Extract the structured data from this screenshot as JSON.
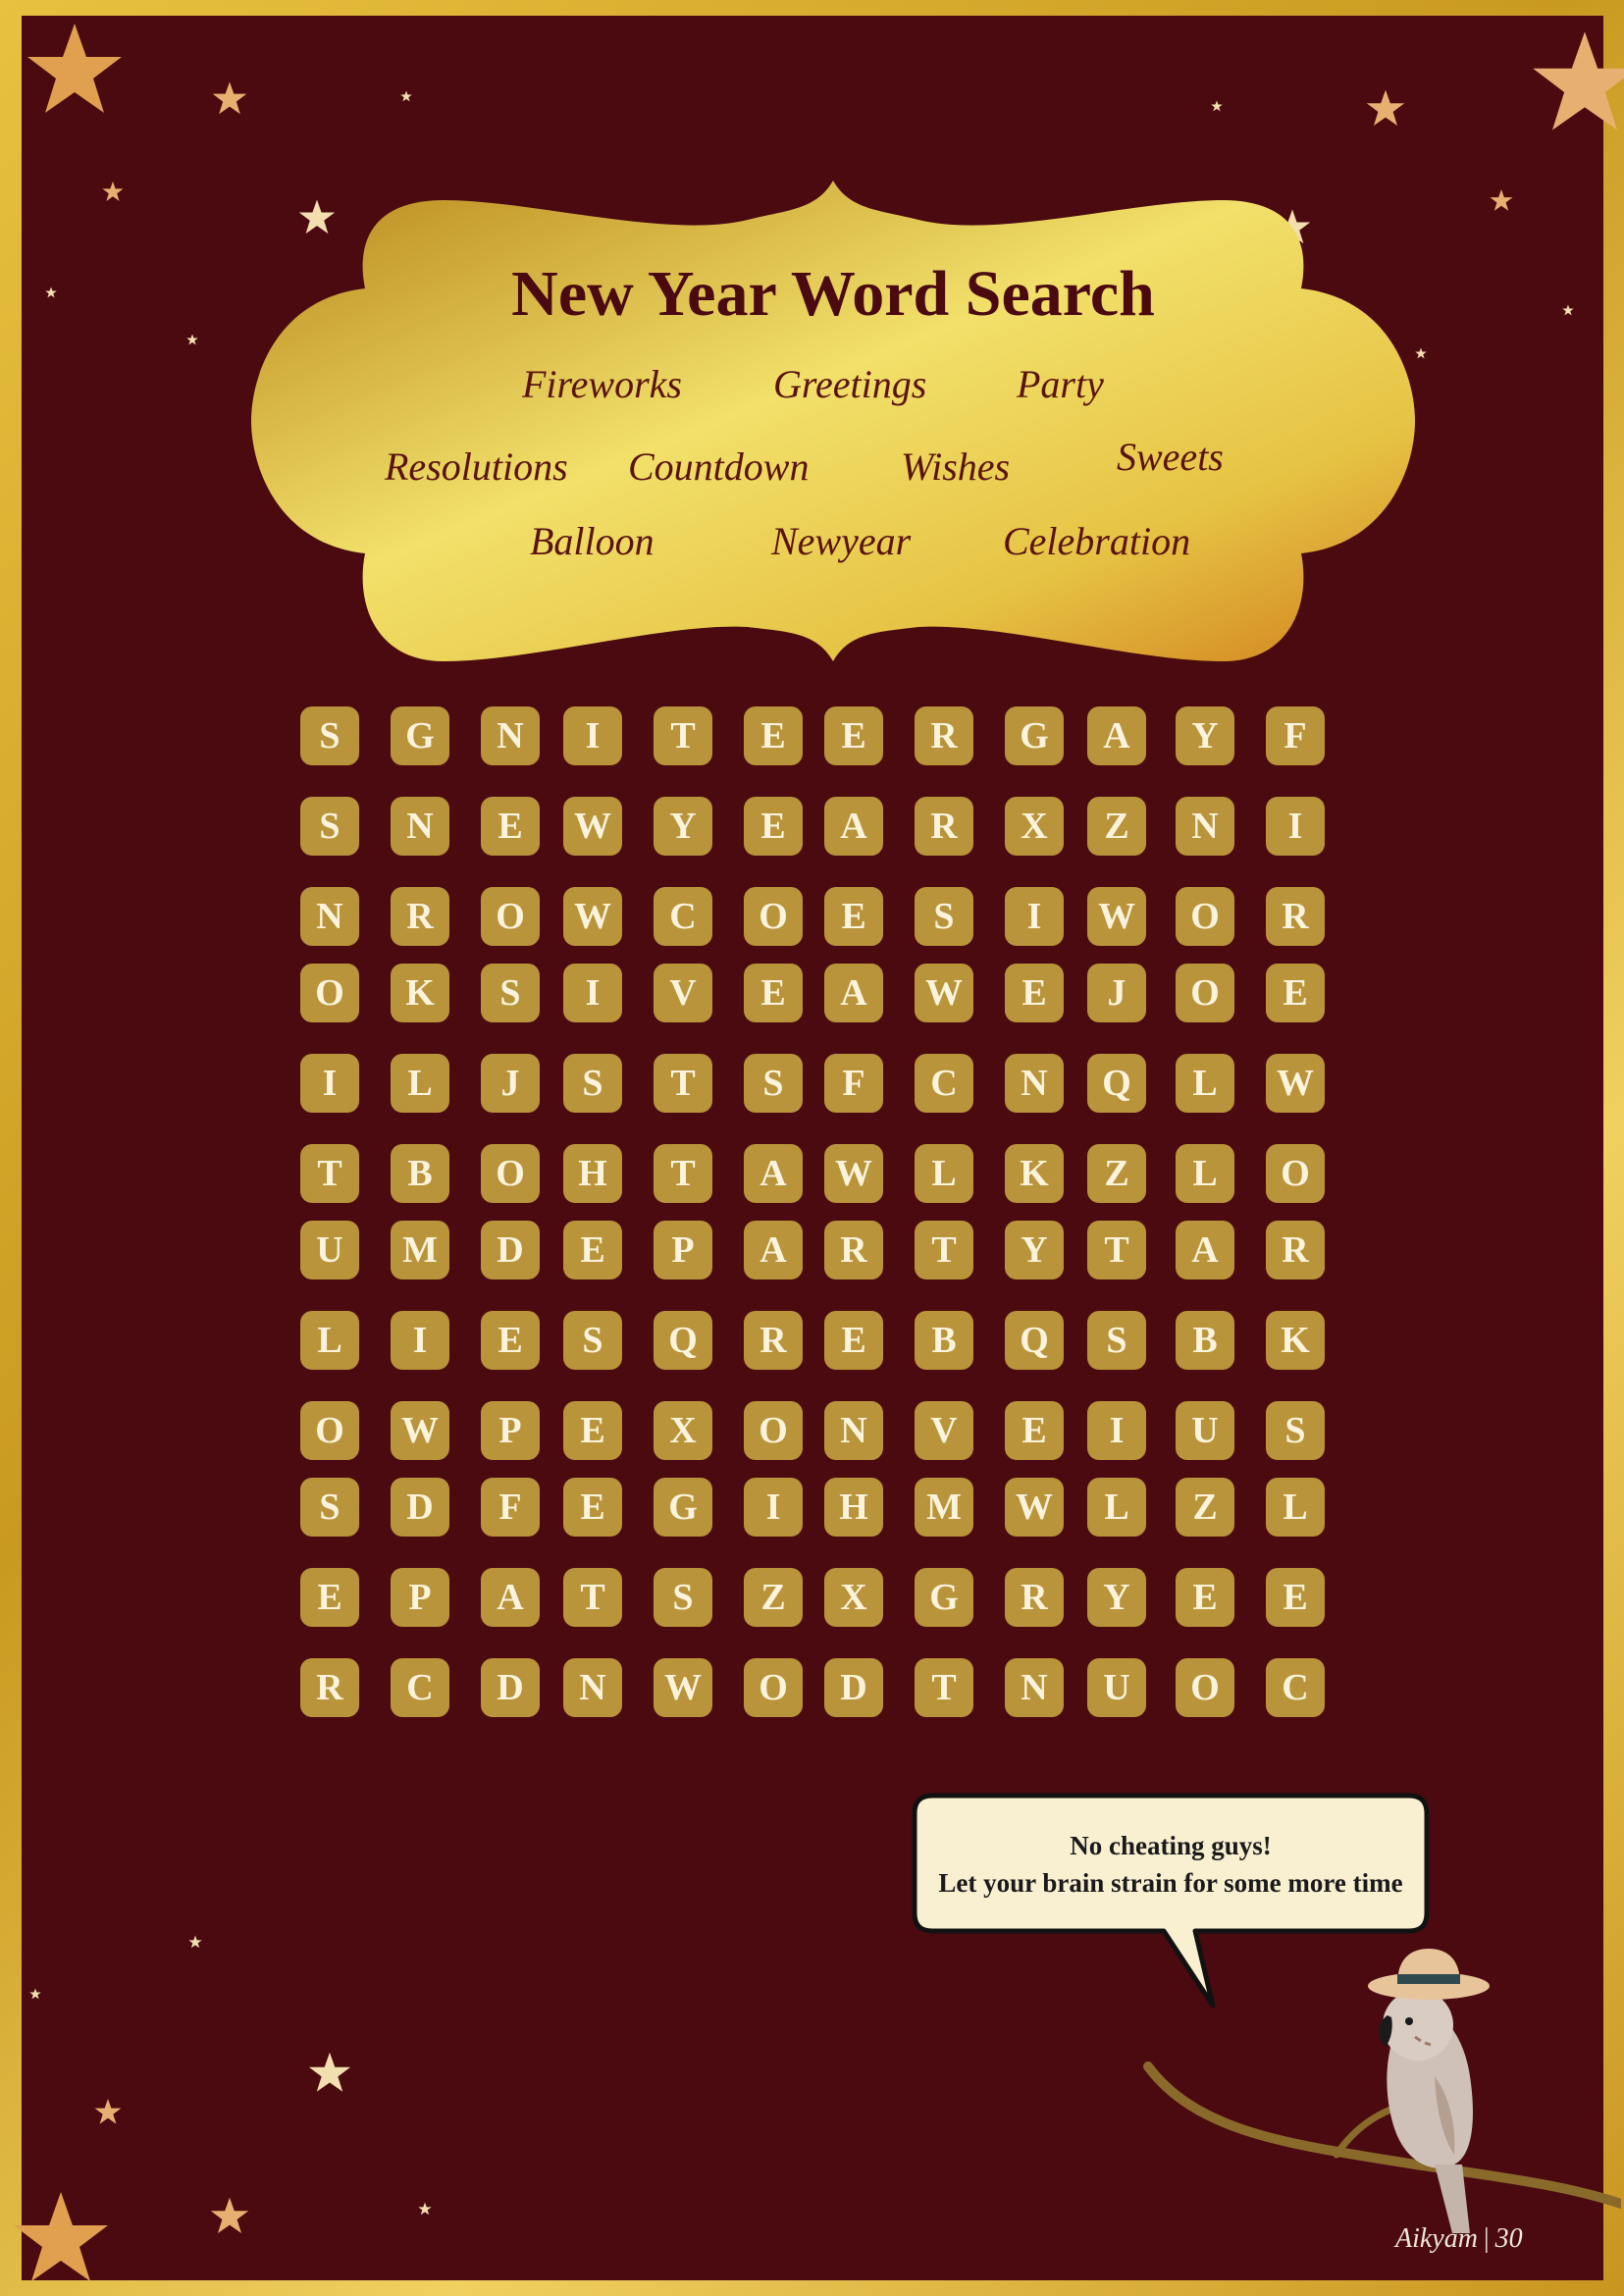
{
  "title": "New Year Word Search",
  "word_list": [
    "Fireworks",
    "Greetings",
    "Party",
    "Resolutions",
    "Countdown",
    "Wishes",
    "Sweets",
    "Balloon",
    "Newyear",
    "Celebration"
  ],
  "grid": [
    [
      "S",
      "G",
      "N",
      "I",
      "T",
      "E",
      "E",
      "R",
      "G",
      "A",
      "Y",
      "F"
    ],
    [
      "S",
      "N",
      "E",
      "W",
      "Y",
      "E",
      "A",
      "R",
      "X",
      "Z",
      "N",
      "I"
    ],
    [
      "N",
      "R",
      "O",
      "W",
      "C",
      "O",
      "E",
      "S",
      "I",
      "W",
      "O",
      "R"
    ],
    [
      "O",
      "K",
      "S",
      "I",
      "V",
      "E",
      "A",
      "W",
      "E",
      "J",
      "O",
      "E"
    ],
    [
      "I",
      "L",
      "J",
      "S",
      "T",
      "S",
      "F",
      "C",
      "N",
      "Q",
      "L",
      "W"
    ],
    [
      "T",
      "B",
      "O",
      "H",
      "T",
      "A",
      "W",
      "L",
      "K",
      "Z",
      "L",
      "O"
    ],
    [
      "U",
      "M",
      "D",
      "E",
      "P",
      "A",
      "R",
      "T",
      "Y",
      "T",
      "A",
      "R"
    ],
    [
      "L",
      "I",
      "E",
      "S",
      "Q",
      "R",
      "E",
      "B",
      "Q",
      "S",
      "B",
      "K"
    ],
    [
      "O",
      "W",
      "P",
      "E",
      "X",
      "O",
      "N",
      "V",
      "E",
      "I",
      "U",
      "S"
    ],
    [
      "S",
      "D",
      "F",
      "E",
      "G",
      "I",
      "H",
      "M",
      "W",
      "L",
      "Z",
      "L"
    ],
    [
      "E",
      "P",
      "A",
      "T",
      "S",
      "Z",
      "X",
      "G",
      "R",
      "Y",
      "E",
      "E"
    ],
    [
      "R",
      "C",
      "D",
      "N",
      "W",
      "O",
      "D",
      "T",
      "N",
      "U",
      "O",
      "C"
    ]
  ],
  "speech_bubble": {
    "line1": "No cheating guys!",
    "line2": "Let your brain strain for some more time"
  },
  "footer": {
    "brand": "Aikyam",
    "separator": "|",
    "page_number": "30"
  },
  "decorations": {
    "icons": [
      "star-icon",
      "parrot-illustration",
      "branch-illustration"
    ]
  },
  "colors": {
    "background": "#4a0a10",
    "gold": "#e8c140",
    "tile": "#b9943a",
    "tile_text": "#fbf3dc",
    "title_text": "#4a0a10"
  }
}
